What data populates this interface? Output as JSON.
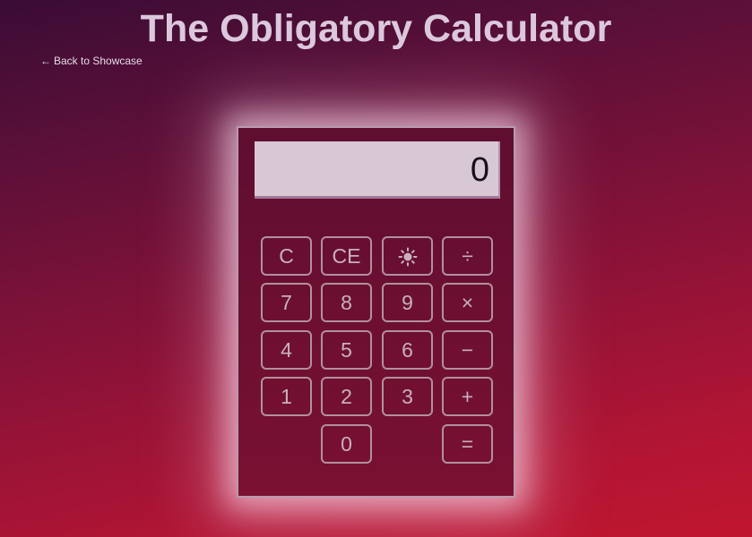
{
  "page": {
    "title": "The Obligatory Calculator",
    "back_link": "Back to Showcase",
    "back_arrow": "←"
  },
  "calculator": {
    "display_value": "0",
    "keys": {
      "clear": "C",
      "clear_entry": "CE",
      "theme_icon": "sun-icon",
      "divide": "÷",
      "seven": "7",
      "eight": "8",
      "nine": "9",
      "multiply": "×",
      "four": "4",
      "five": "5",
      "six": "6",
      "subtract": "−",
      "one": "1",
      "two": "2",
      "three": "3",
      "add": "+",
      "zero": "0",
      "equals": "="
    }
  },
  "colors": {
    "gradient_top": "#3a0c35",
    "gradient_bottom": "#c0162f",
    "title_text": "#dcc8dc",
    "key_border": "#b1909f",
    "display_bg": "#d8c8d6"
  }
}
